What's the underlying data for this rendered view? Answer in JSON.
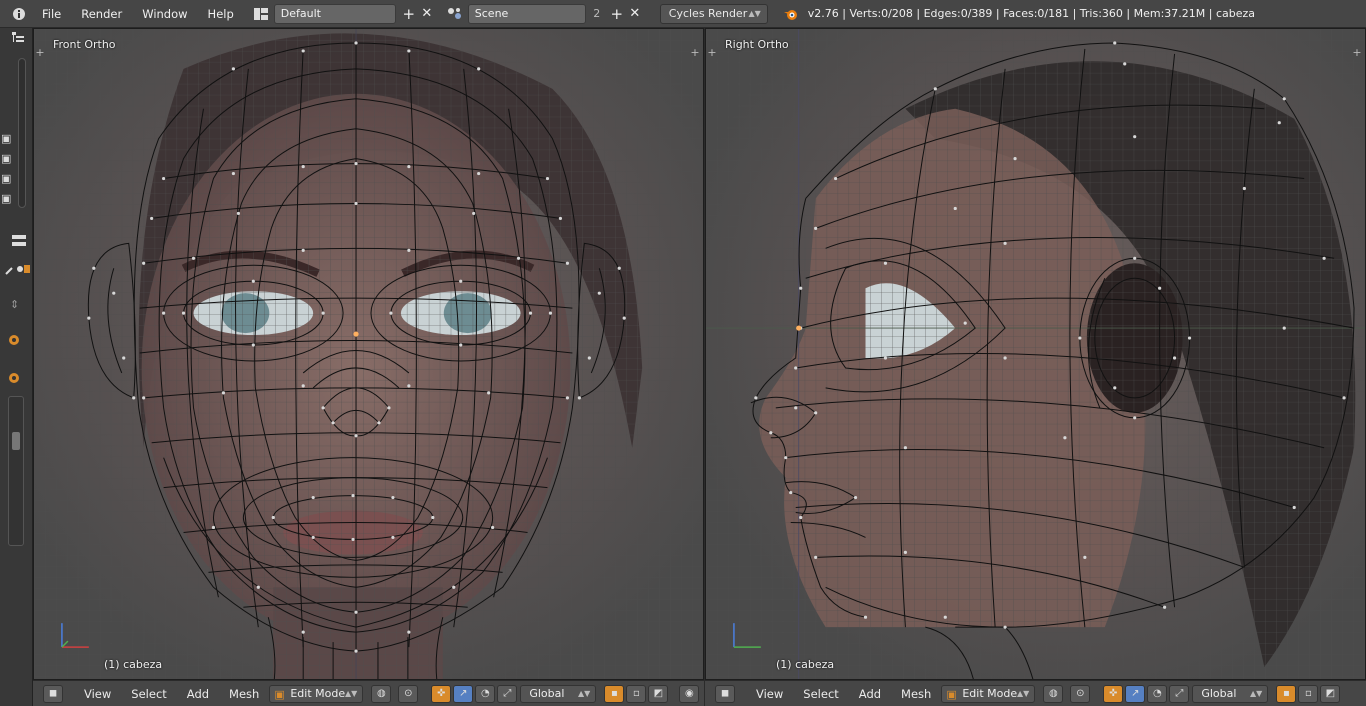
{
  "topbar": {
    "menus": [
      "File",
      "Render",
      "Window",
      "Help"
    ],
    "layout_field": "Default",
    "scene_field": "Scene",
    "scene_users": "2",
    "render_engine": "Cycles Render",
    "stats": "v2.76 | Verts:0/208 | Edges:0/389 | Faces:0/181 | Tris:360 | Mem:37.21M | cabeza"
  },
  "viewport_left": {
    "label": "Front Ortho",
    "object_label": "(1) cabeza"
  },
  "viewport_right": {
    "label": "Right Ortho",
    "object_label": "(1) cabeza"
  },
  "bottombar": {
    "menus": [
      "View",
      "Select",
      "Add",
      "Mesh"
    ],
    "mode": "Edit Mode",
    "orientation": "Global"
  },
  "colors": {
    "header_bg": "#464646",
    "accent_blue": "#5680c2",
    "accent_orange": "#d98b2b",
    "wire": "#111111",
    "vertex": "#d8d8d8"
  },
  "icons": [
    "info-icon",
    "screen-layout-icon",
    "scene-icon",
    "blender-logo-icon",
    "cube-icon",
    "pivot-icon",
    "manipulator-icon"
  ]
}
